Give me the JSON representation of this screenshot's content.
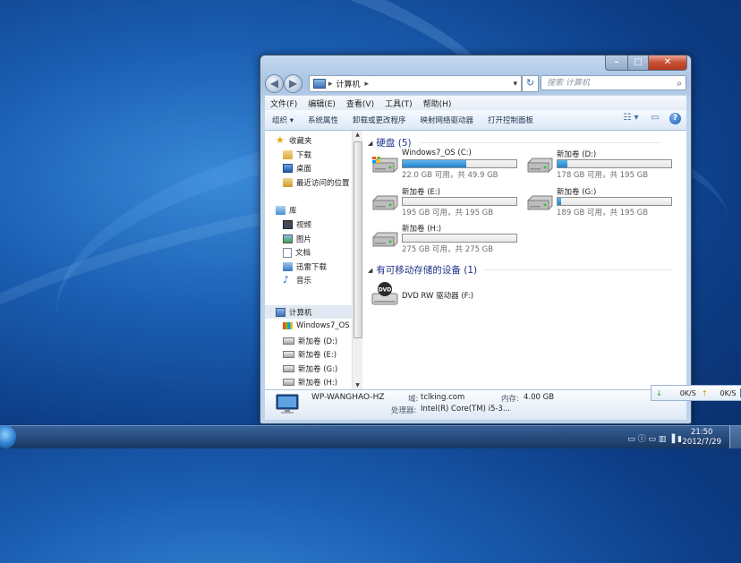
{
  "window": {
    "caption_min": "–",
    "caption_max": "□",
    "caption_close": "✕",
    "nav_back": "◀",
    "nav_fwd": "▶",
    "address_sep1": "▸",
    "address_path": "计算机",
    "address_sep2": "▸",
    "address_dropdown": "▾",
    "refresh": "↻",
    "search_placeholder": "搜索 计算机",
    "search_icon": "⌕"
  },
  "menu": [
    "文件(F)",
    "编辑(E)",
    "查看(V)",
    "工具(T)",
    "帮助(H)"
  ],
  "commands": [
    "组织 ▾",
    "系统属性",
    "卸载或更改程序",
    "映射网络驱动器",
    "打开控制面板"
  ],
  "cmd_icons": {
    "views": "☷ ▾",
    "pane": "▭",
    "help": "?"
  },
  "nav": {
    "favorites": "收藏夹",
    "downloads": "下载",
    "desktop": "桌面",
    "recent": "最近访问的位置",
    "libraries": "库",
    "videos": "视频",
    "pictures": "图片",
    "documents": "文档",
    "thunder": "迅雷下载",
    "music": "音乐",
    "computer": "计算机",
    "drive_c": "Windows7_OS (",
    "drive_d": "新加卷 (D:)",
    "drive_e": "新加卷 (E:)",
    "drive_g": "新加卷 (G:)",
    "drive_h": "新加卷 (H:)"
  },
  "groups": {
    "hdd": "硬盘 (5)",
    "removable": "有可移动存储的设备 (1)"
  },
  "drives": [
    {
      "name": "Windows7_OS (C:)",
      "size": "22.0 GB 可用，共 49.9 GB",
      "used_fraction": 0.56
    },
    {
      "name": "新加卷 (D:)",
      "size": "178 GB 可用，共 195 GB",
      "used_fraction": 0.09
    },
    {
      "name": "新加卷 (E:)",
      "size": "195 GB 可用，共 195 GB",
      "used_fraction": 0.0
    },
    {
      "name": "新加卷 (G:)",
      "size": "189 GB 可用，共 195 GB",
      "used_fraction": 0.03
    },
    {
      "name": "新加卷 (H:)",
      "size": "275 GB 可用，共 275 GB",
      "used_fraction": 0.0
    }
  ],
  "dvd": {
    "name": "DVD RW 驱动器 (F:)",
    "badge": "DVD"
  },
  "details": {
    "computer_name": "WP-WANGHAO-HZ",
    "domain_label": "域:",
    "domain_value": "tclking.com",
    "memory_label": "内存:",
    "memory_value": "4.00 GB",
    "cpu_label": "处理器:",
    "cpu_value": "Intel(R) Core(TM) i5-3..."
  },
  "netspeed": {
    "down": "0K/S",
    "up": "0K/S",
    "down_icon": "↓",
    "up_icon": "↑"
  },
  "taskbar": {
    "time": "21:50",
    "date": "2012/7/29",
    "tray_icons": "▭  ⓘ  ▭  ▥  ▐  ▮"
  },
  "colors": {
    "accent": "#1e3287",
    "progress": "#2283cd",
    "desktop": "#1b5fb3"
  }
}
